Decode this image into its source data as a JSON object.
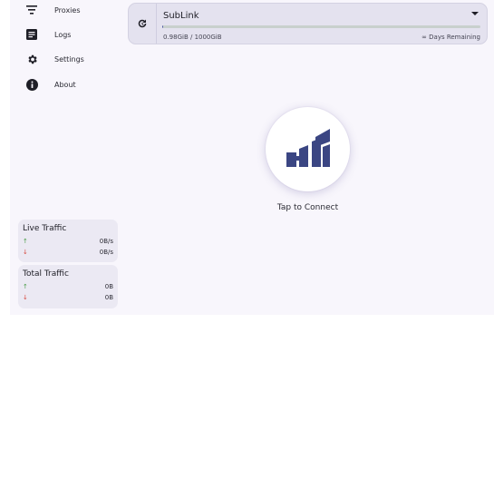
{
  "nav": {
    "items": [
      {
        "label": "Proxies",
        "icon": "filter-list-icon"
      },
      {
        "label": "Logs",
        "icon": "document-icon"
      },
      {
        "label": "Settings",
        "icon": "gear-icon"
      },
      {
        "label": "About",
        "icon": "info-icon"
      }
    ]
  },
  "live_traffic": {
    "title": "Live Traffic",
    "up_arrow": "↑",
    "down_arrow": "↓",
    "up_value": "0B/s",
    "down_value": "0B/s"
  },
  "total_traffic": {
    "title": "Total Traffic",
    "up_arrow": "↑",
    "down_arrow": "↓",
    "up_value": "0B",
    "down_value": "0B"
  },
  "profile": {
    "name": "SubLink",
    "usage": "0.98GiB / 1000GiB",
    "usage_fraction": 0.00098,
    "remaining": "∞ Days Remaining"
  },
  "connect": {
    "label": "Tap to Connect"
  },
  "colors": {
    "accent": "#4e5aa0",
    "logo": "#3b4683",
    "up": "#4a9d48",
    "down": "#d6453a",
    "background": "#f8f6fc"
  }
}
